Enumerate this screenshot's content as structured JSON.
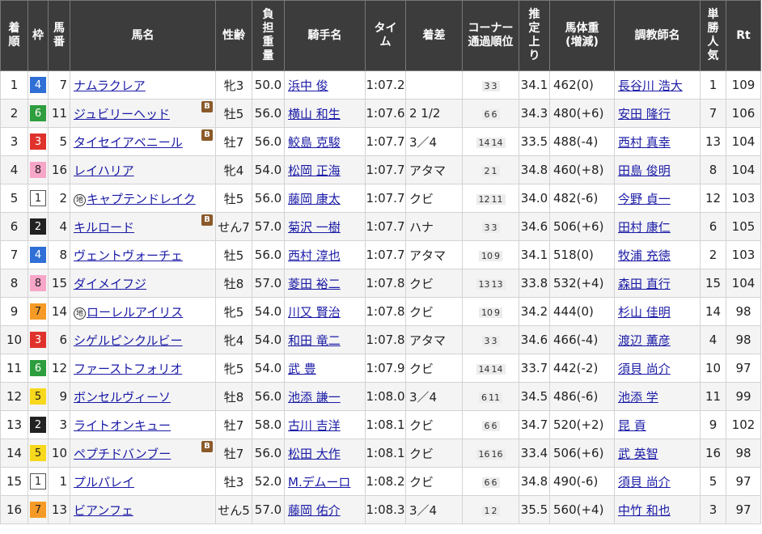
{
  "headers": {
    "rank": "着順",
    "waku": "枠",
    "num": "馬番",
    "horse": "馬名",
    "sexage": "性齢",
    "weight": "負担重量",
    "jockey": "騎手名",
    "time": "タイム",
    "margin": "着差",
    "corner": "コーナー通過順位",
    "last3f": "推定上り",
    "body": "馬体重(増減)",
    "trainer": "調教師名",
    "pop": "単勝人気",
    "rt": "Rt"
  },
  "header_lines": {
    "rank": [
      "着",
      "順"
    ],
    "waku": [
      "枠"
    ],
    "num": [
      "馬",
      "番"
    ],
    "horse": [
      "馬名"
    ],
    "sexage": [
      "性齢"
    ],
    "weight": [
      "負",
      "担",
      "重",
      "量"
    ],
    "jockey": [
      "騎手名"
    ],
    "time": [
      "タイ",
      "ム"
    ],
    "margin": [
      "着差"
    ],
    "corner": [
      "コーナー",
      "通過順位"
    ],
    "last3f": [
      "推",
      "定",
      "上",
      "り"
    ],
    "body": [
      "馬体重",
      "(増減)"
    ],
    "trainer": [
      "調教師名"
    ],
    "pop": [
      "単",
      "勝",
      "人",
      "気"
    ],
    "rt": [
      "Rt"
    ]
  },
  "blinker_label": "B",
  "chiho_label": "地",
  "waku_colors": {
    "1": {
      "bg": "#ffffff",
      "fg": "#222222",
      "border": "#555555"
    },
    "2": {
      "bg": "#222222",
      "fg": "#ffffff",
      "border": "#222222"
    },
    "3": {
      "bg": "#e0322c",
      "fg": "#ffffff",
      "border": "#e0322c"
    },
    "4": {
      "bg": "#2f6fd6",
      "fg": "#ffffff",
      "border": "#2f6fd6"
    },
    "5": {
      "bg": "#f7d81c",
      "fg": "#222222",
      "border": "#f7d81c"
    },
    "6": {
      "bg": "#2e9e3e",
      "fg": "#ffffff",
      "border": "#2e9e3e"
    },
    "7": {
      "bg": "#f59a26",
      "fg": "#222222",
      "border": "#f59a26"
    },
    "8": {
      "bg": "#f7a6c8",
      "fg": "#222222",
      "border": "#f7a6c8"
    }
  },
  "rows": [
    {
      "rank": "1",
      "waku": "4",
      "num": "7",
      "horse": "ナムラクレア",
      "blinker": false,
      "chiho": false,
      "sexage": "牝3",
      "weight": "50.0",
      "jockey": "浜中 俊",
      "time": "1:07.2",
      "margin": "",
      "corner": [
        "3",
        "3"
      ],
      "last3f": "34.1",
      "body": "462(0)",
      "trainer": "長谷川 浩大",
      "pop": "1",
      "rt": "109"
    },
    {
      "rank": "2",
      "waku": "6",
      "num": "11",
      "horse": "ジュビリーヘッド",
      "blinker": true,
      "chiho": false,
      "sexage": "牡5",
      "weight": "56.0",
      "jockey": "横山 和生",
      "time": "1:07.6",
      "margin": "2 1/2",
      "corner": [
        "6",
        "6"
      ],
      "last3f": "34.3",
      "body": "480(+6)",
      "trainer": "安田 隆行",
      "pop": "7",
      "rt": "106"
    },
    {
      "rank": "3",
      "waku": "3",
      "num": "5",
      "horse": "タイセイアベニール",
      "blinker": true,
      "chiho": false,
      "sexage": "牡7",
      "weight": "56.0",
      "jockey": "鮫島 克駿",
      "time": "1:07.7",
      "margin": "3／4",
      "corner": [
        "14",
        "14"
      ],
      "last3f": "33.5",
      "body": "488(-4)",
      "trainer": "西村 真幸",
      "pop": "13",
      "rt": "104"
    },
    {
      "rank": "4",
      "waku": "8",
      "num": "16",
      "horse": "レイハリア",
      "blinker": false,
      "chiho": false,
      "sexage": "牝4",
      "weight": "54.0",
      "jockey": "松岡 正海",
      "time": "1:07.7",
      "margin": "アタマ",
      "corner": [
        "2",
        "1"
      ],
      "last3f": "34.8",
      "body": "460(+8)",
      "trainer": "田島 俊明",
      "pop": "8",
      "rt": "104"
    },
    {
      "rank": "5",
      "waku": "1",
      "num": "2",
      "horse": "キャプテンドレイク",
      "blinker": false,
      "chiho": true,
      "sexage": "牡5",
      "weight": "56.0",
      "jockey": "藤岡 康太",
      "time": "1:07.7",
      "margin": "クビ",
      "corner": [
        "12",
        "11"
      ],
      "last3f": "34.0",
      "body": "482(-6)",
      "trainer": "今野 貞一",
      "pop": "12",
      "rt": "103"
    },
    {
      "rank": "6",
      "waku": "2",
      "num": "4",
      "horse": "キルロード",
      "blinker": true,
      "chiho": false,
      "sexage": "せん7",
      "weight": "57.0",
      "jockey": "菊沢 一樹",
      "time": "1:07.7",
      "margin": "ハナ",
      "corner": [
        "3",
        "3"
      ],
      "last3f": "34.6",
      "body": "506(+6)",
      "trainer": "田村 康仁",
      "pop": "6",
      "rt": "105"
    },
    {
      "rank": "7",
      "waku": "4",
      "num": "8",
      "horse": "ヴェントヴォーチェ",
      "blinker": false,
      "chiho": false,
      "sexage": "牡5",
      "weight": "56.0",
      "jockey": "西村 淳也",
      "time": "1:07.7",
      "margin": "アタマ",
      "corner": [
        "10",
        "9"
      ],
      "last3f": "34.1",
      "body": "518(0)",
      "trainer": "牧浦 充徳",
      "pop": "2",
      "rt": "103"
    },
    {
      "rank": "8",
      "waku": "8",
      "num": "15",
      "horse": "ダイメイフジ",
      "blinker": false,
      "chiho": false,
      "sexage": "牡8",
      "weight": "57.0",
      "jockey": "菱田 裕二",
      "time": "1:07.8",
      "margin": "クビ",
      "corner": [
        "13",
        "13"
      ],
      "last3f": "33.8",
      "body": "532(+4)",
      "trainer": "森田 直行",
      "pop": "15",
      "rt": "104"
    },
    {
      "rank": "9",
      "waku": "7",
      "num": "14",
      "horse": "ローレルアイリス",
      "blinker": false,
      "chiho": true,
      "sexage": "牝5",
      "weight": "54.0",
      "jockey": "川又 賢治",
      "time": "1:07.8",
      "margin": "クビ",
      "corner": [
        "10",
        "9"
      ],
      "last3f": "34.2",
      "body": "444(0)",
      "trainer": "杉山 佳明",
      "pop": "14",
      "rt": "98"
    },
    {
      "rank": "10",
      "waku": "3",
      "num": "6",
      "horse": "シゲルピンクルビー",
      "blinker": false,
      "chiho": false,
      "sexage": "牝4",
      "weight": "54.0",
      "jockey": "和田 竜二",
      "time": "1:07.8",
      "margin": "アタマ",
      "corner": [
        "3",
        "3"
      ],
      "last3f": "34.6",
      "body": "466(-4)",
      "trainer": "渡辺 薫彦",
      "pop": "4",
      "rt": "98"
    },
    {
      "rank": "11",
      "waku": "6",
      "num": "12",
      "horse": "ファーストフォリオ",
      "blinker": false,
      "chiho": false,
      "sexage": "牝5",
      "weight": "54.0",
      "jockey": "武 豊",
      "time": "1:07.9",
      "margin": "クビ",
      "corner": [
        "14",
        "14"
      ],
      "last3f": "33.7",
      "body": "442(-2)",
      "trainer": "須貝 尚介",
      "pop": "10",
      "rt": "97"
    },
    {
      "rank": "12",
      "waku": "5",
      "num": "9",
      "horse": "ボンセルヴィーソ",
      "blinker": false,
      "chiho": false,
      "sexage": "牡8",
      "weight": "56.0",
      "jockey": "池添 謙一",
      "time": "1:08.0",
      "margin": "3／4",
      "corner": [
        "6",
        "11"
      ],
      "last3f": "34.5",
      "body": "486(-6)",
      "trainer": "池添 学",
      "pop": "11",
      "rt": "99"
    },
    {
      "rank": "13",
      "waku": "2",
      "num": "3",
      "horse": "ライトオンキュー",
      "blinker": false,
      "chiho": false,
      "sexage": "牡7",
      "weight": "58.0",
      "jockey": "古川 吉洋",
      "time": "1:08.1",
      "margin": "クビ",
      "corner": [
        "6",
        "6"
      ],
      "last3f": "34.7",
      "body": "520(+2)",
      "trainer": "昆 貢",
      "pop": "9",
      "rt": "102"
    },
    {
      "rank": "14",
      "waku": "5",
      "num": "10",
      "horse": "ペプチドバンブー",
      "blinker": true,
      "chiho": false,
      "sexage": "牡7",
      "weight": "56.0",
      "jockey": "松田 大作",
      "time": "1:08.1",
      "margin": "クビ",
      "corner": [
        "16",
        "16"
      ],
      "last3f": "33.4",
      "body": "506(+6)",
      "trainer": "武 英智",
      "pop": "16",
      "rt": "98"
    },
    {
      "rank": "15",
      "waku": "1",
      "num": "1",
      "horse": "プルパレイ",
      "blinker": false,
      "chiho": false,
      "sexage": "牡3",
      "weight": "52.0",
      "jockey": "M.デムーロ",
      "time": "1:08.2",
      "margin": "クビ",
      "corner": [
        "6",
        "6"
      ],
      "last3f": "34.8",
      "body": "490(-6)",
      "trainer": "須貝 尚介",
      "pop": "5",
      "rt": "97"
    },
    {
      "rank": "16",
      "waku": "7",
      "num": "13",
      "horse": "ビアンフェ",
      "blinker": false,
      "chiho": false,
      "sexage": "せん5",
      "weight": "57.0",
      "jockey": "藤岡 佑介",
      "time": "1:08.3",
      "margin": "3／4",
      "corner": [
        "1",
        "2"
      ],
      "last3f": "35.5",
      "body": "560(+4)",
      "trainer": "中竹 和也",
      "pop": "3",
      "rt": "97"
    }
  ]
}
